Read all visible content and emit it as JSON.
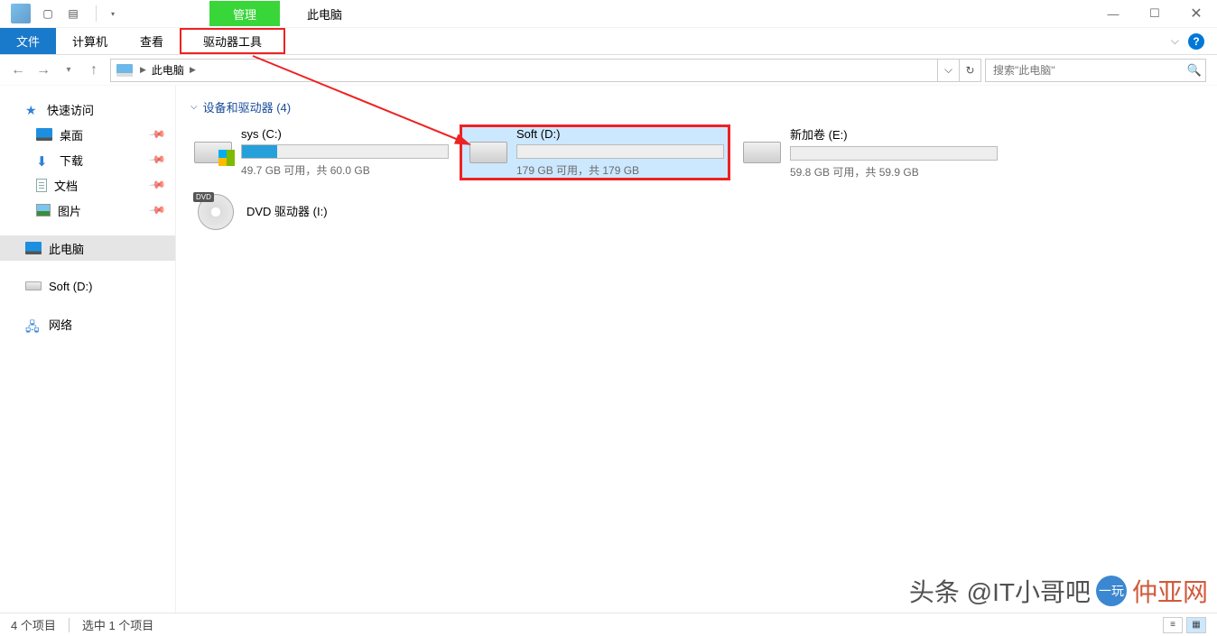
{
  "titlebar": {
    "context_tab": "管理",
    "title": "此电脑"
  },
  "ribbon": {
    "file": "文件",
    "computer": "计算机",
    "view": "查看",
    "drive_tools": "驱动器工具"
  },
  "addr": {
    "root": "此电脑"
  },
  "search": {
    "placeholder": "搜索\"此电脑\""
  },
  "sidebar": {
    "quick": "快速访问",
    "items": [
      {
        "label": "桌面"
      },
      {
        "label": "下载"
      },
      {
        "label": "文档"
      },
      {
        "label": "图片"
      }
    ],
    "this_pc": "此电脑",
    "soft_d": "Soft (D:)",
    "network": "网络"
  },
  "content": {
    "group_label": "设备和驱动器 (4)",
    "drives": [
      {
        "name": "sys (C:)",
        "sub": "49.7 GB 可用，共 60.0 GB",
        "fill_pct": 17
      },
      {
        "name": "Soft (D:)",
        "sub": "179 GB 可用，共 179 GB",
        "fill_pct": 0
      },
      {
        "name": "新加卷 (E:)",
        "sub": "59.8 GB 可用，共 59.9 GB",
        "fill_pct": 0
      }
    ],
    "dvd": {
      "name": "DVD 驱动器 (I:)"
    }
  },
  "status": {
    "count": "4 个项目",
    "selected": "选中 1 个项目"
  },
  "watermark": {
    "text": "头条 @IT小哥吧",
    "brand": "一玩",
    "trail": "仲亚网"
  }
}
